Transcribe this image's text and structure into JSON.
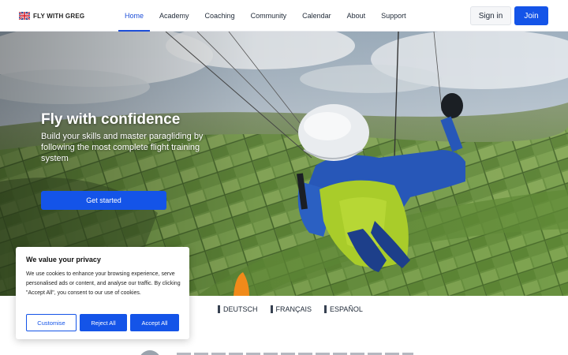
{
  "brand": {
    "name": "FLY WITH GREG",
    "logo_icon": "brand-flag-icon"
  },
  "nav": {
    "items": [
      {
        "label": "Home",
        "active": true
      },
      {
        "label": "Academy",
        "active": false
      },
      {
        "label": "Coaching",
        "active": false
      },
      {
        "label": "Community",
        "active": false
      },
      {
        "label": "Calendar",
        "active": false
      },
      {
        "label": "About",
        "active": false
      },
      {
        "label": "Support",
        "active": false
      }
    ],
    "signin_label": "Sign in",
    "join_label": "Join"
  },
  "hero": {
    "title": "Fly with confidence",
    "subtitle": "Build your skills and master paragliding by following the most complete flight training system",
    "cta_label": "Get started"
  },
  "languages": [
    {
      "label": "DEUTSCH"
    },
    {
      "label": "FRANÇAIS"
    },
    {
      "label": "ESPAÑOL"
    }
  ],
  "cookie": {
    "title": "We value your privacy",
    "text": "We use cookies to enhance your browsing experience, serve personalised ads or content, and analyse our traffic. By clicking \"Accept All\", you consent to our use of cookies.",
    "customise_label": "Customise",
    "reject_label": "Reject All",
    "accept_label": "Accept All"
  },
  "colors": {
    "accent": "#1454e8",
    "nav_active": "#1d4ed8"
  }
}
